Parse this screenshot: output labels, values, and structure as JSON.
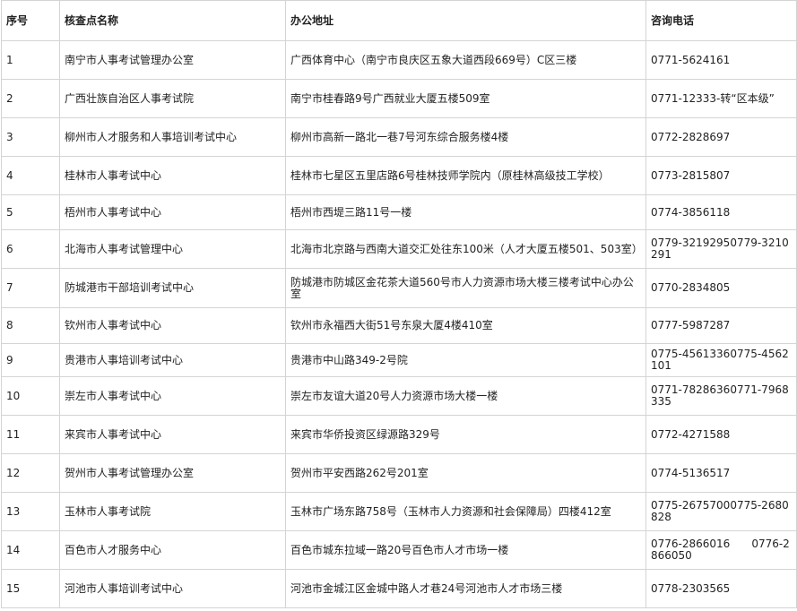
{
  "table": {
    "headers": {
      "index": "序号",
      "name": "核查点名称",
      "address": "办公地址",
      "phone": "咨询电话"
    },
    "rows": [
      {
        "index": "1",
        "name": "南宁市人事考试管理办公室",
        "address": "广西体育中心（南宁市良庆区五象大道西段669号）C区三楼",
        "phone": "0771-5624161"
      },
      {
        "index": "2",
        "name": "广西壮族自治区人事考试院",
        "address": "南宁市桂春路9号广西就业大厦五楼509室",
        "phone": "0771-12333-转“区本级”"
      },
      {
        "index": "3",
        "name": "柳州市人才服务和人事培训考试中心",
        "address": "柳州市高新一路北一巷7号河东综合服务楼4楼",
        "phone": "0772-2828697"
      },
      {
        "index": "4",
        "name": "桂林市人事考试中心",
        "address": "桂林市七星区五里店路6号桂林技师学院内（原桂林高级技工学校）",
        "phone": "0773-2815807"
      },
      {
        "index": "5",
        "name": "梧州市人事考试中心",
        "address": "梧州市西堤三路11号一楼",
        "phone": "0774-3856118"
      },
      {
        "index": "6",
        "name": "北海市人事考试管理中心",
        "address": "北海市北京路与西南大道交汇处往东100米（人才大厦五楼501、503室）",
        "phone": "0779-32192950779-3210291"
      },
      {
        "index": "7",
        "name": "防城港市干部培训考试中心",
        "address": "防城港市防城区金花茶大道560号市人力资源市场大楼三楼考试中心办公室",
        "phone": "0770-2834805"
      },
      {
        "index": "8",
        "name": "钦州市人事考试中心",
        "address": "钦州市永福西大街51号东泉大厦4楼410室",
        "phone": "0777-5987287"
      },
      {
        "index": "9",
        "name": "贵港市人事培训考试中心",
        "address": "贵港市中山路349-2号院",
        "phone": "0775-45613360775-4562101"
      },
      {
        "index": "10",
        "name": "崇左市人事考试中心",
        "address": "崇左市友谊大道20号人力资源市场大楼一楼",
        "phone": "0771-78286360771-7968335"
      },
      {
        "index": "11",
        "name": "来宾市人事考试中心",
        "address": "来宾市华侨投资区绿源路329号",
        "phone": "0772-4271588"
      },
      {
        "index": "12",
        "name": "贺州市人事考试管理办公室",
        "address": "贺州市平安西路262号201室",
        "phone": "0774-5136517"
      },
      {
        "index": "13",
        "name": "玉林市人事考试院",
        "address": "玉林市广场东路758号（玉林市人力资源和社会保障局）四楼412室",
        "phone": "0775-26757000775-2680828"
      },
      {
        "index": "14",
        "name": "百色市人才服务中心",
        "address": "百色市城东拉域一路20号百色市人才市场一楼",
        "phone": "0776-2866016　　0776-2866050"
      },
      {
        "index": "15",
        "name": "河池市人事培训考试中心",
        "address": "河池市金城江区金城中路人才巷24号河池市人才市场三楼",
        "phone": "0778-2303565"
      }
    ]
  }
}
